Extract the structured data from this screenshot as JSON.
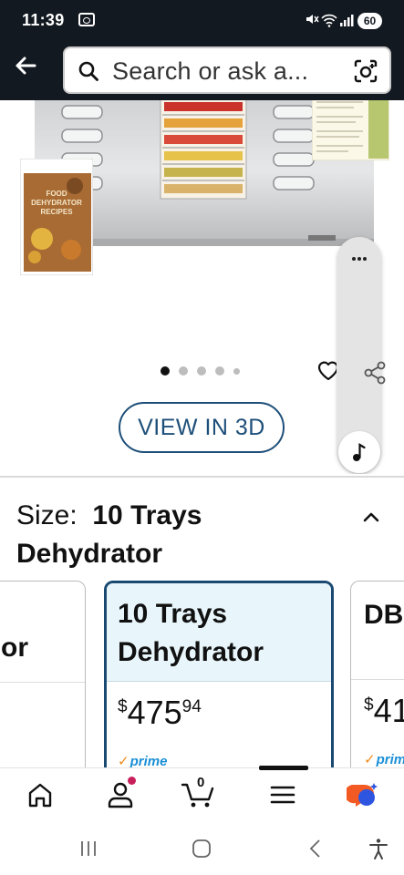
{
  "status_bar": {
    "time": "11:39",
    "battery": "60"
  },
  "search": {
    "placeholder": "Search or ask a..."
  },
  "product": {
    "book_title": "FOOD DEHYDRATOR RECIPES",
    "image_dots": {
      "count": 5,
      "active": 0
    },
    "view_3d_label": "VIEW IN 3D"
  },
  "size": {
    "label": "Size:",
    "value": "10 Trays Dehydrator",
    "options": [
      {
        "title": "or",
        "price_symbol": "",
        "price_whole": "",
        "price_fraction": "",
        "prime": ""
      },
      {
        "title": "10 Trays Dehydrator",
        "price_symbol": "$",
        "price_whole": "475",
        "price_fraction": "94",
        "prime": "prime",
        "selected": true
      },
      {
        "title": "DB",
        "price_symbol": "$",
        "price_whole": "41",
        "price_fraction": "",
        "prime": "prim"
      }
    ]
  },
  "bottom_nav": {
    "cart_count": "0",
    "items": [
      "home",
      "account",
      "cart",
      "menu",
      "rufus"
    ]
  },
  "colors": {
    "header_bg": "#131921",
    "accent_blue": "#1a4a72",
    "selected_card_bg": "#e8f6fb",
    "prime_blue": "#1a8fd6",
    "prime_orange": "#f08a1c",
    "badge_pink": "#c7205b"
  }
}
